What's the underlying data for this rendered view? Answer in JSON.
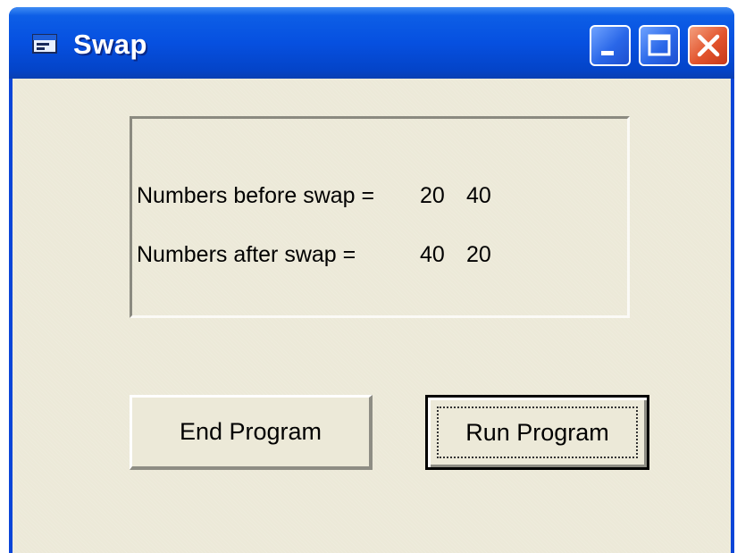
{
  "window": {
    "title": "Swap",
    "icons": {
      "app": "app-form-icon",
      "minimize": "minimize-icon",
      "maximize": "maximize-icon",
      "close": "close-icon"
    },
    "colors": {
      "titlebar": "#0650e0",
      "client": "#ece9d8",
      "close_button": "#e2542d"
    }
  },
  "output": {
    "before_label": "Numbers before swap =",
    "before_a": "20",
    "before_b": "40",
    "after_label": "Numbers after swap =",
    "after_a": "40",
    "after_b": "20"
  },
  "buttons": {
    "end_label": "End Program",
    "run_label": "Run Program"
  }
}
